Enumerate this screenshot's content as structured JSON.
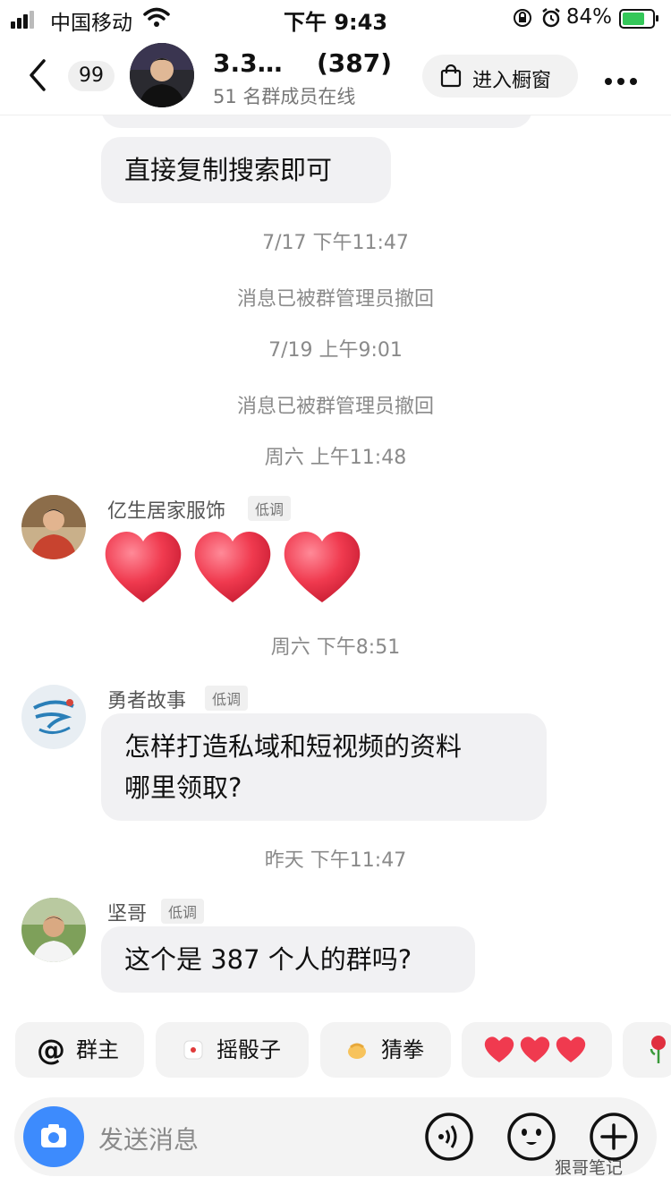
{
  "status_bar": {
    "carrier": "中国移动",
    "time": "下午 9:43",
    "battery": "84%",
    "battery_level": 0.84
  },
  "header": {
    "back_count": "99",
    "group_title": "3.3…",
    "member_count": "(387)",
    "online": "51 名群成员在线",
    "shop_label": "进入橱窗"
  },
  "messages": {
    "m1": "直接复制搜索即可",
    "ts1": "7/17 下午11:47",
    "sys1": "消息已被群管理员撤回",
    "ts2": "7/19 上午9:01",
    "sys2": "消息已被群管理员撤回",
    "ts3": "周六 上午11:48",
    "u1_name": "亿生居家服饰",
    "u1_tag": "低调",
    "ts4": "周六 下午8:51",
    "u2_name": "勇者故事",
    "u2_tag": "低调",
    "m2_line1": "怎样打造私域和短视频的资料",
    "m2_line2": "哪里领取?",
    "ts5": "昨天 下午11:47",
    "u3_name": "坚哥",
    "u3_tag": "低调",
    "m3": "这个是 387 个人的群吗?"
  },
  "quick_actions": {
    "q1": "群主",
    "q2": "摇骰子",
    "q3": "猜拳"
  },
  "input": {
    "placeholder": "发送消息"
  },
  "watermark": "狠哥笔记",
  "colors": {
    "bubble": "#f1f1f3",
    "accent_blue": "#3d8bfd",
    "heart_red": "#f03a4f"
  }
}
